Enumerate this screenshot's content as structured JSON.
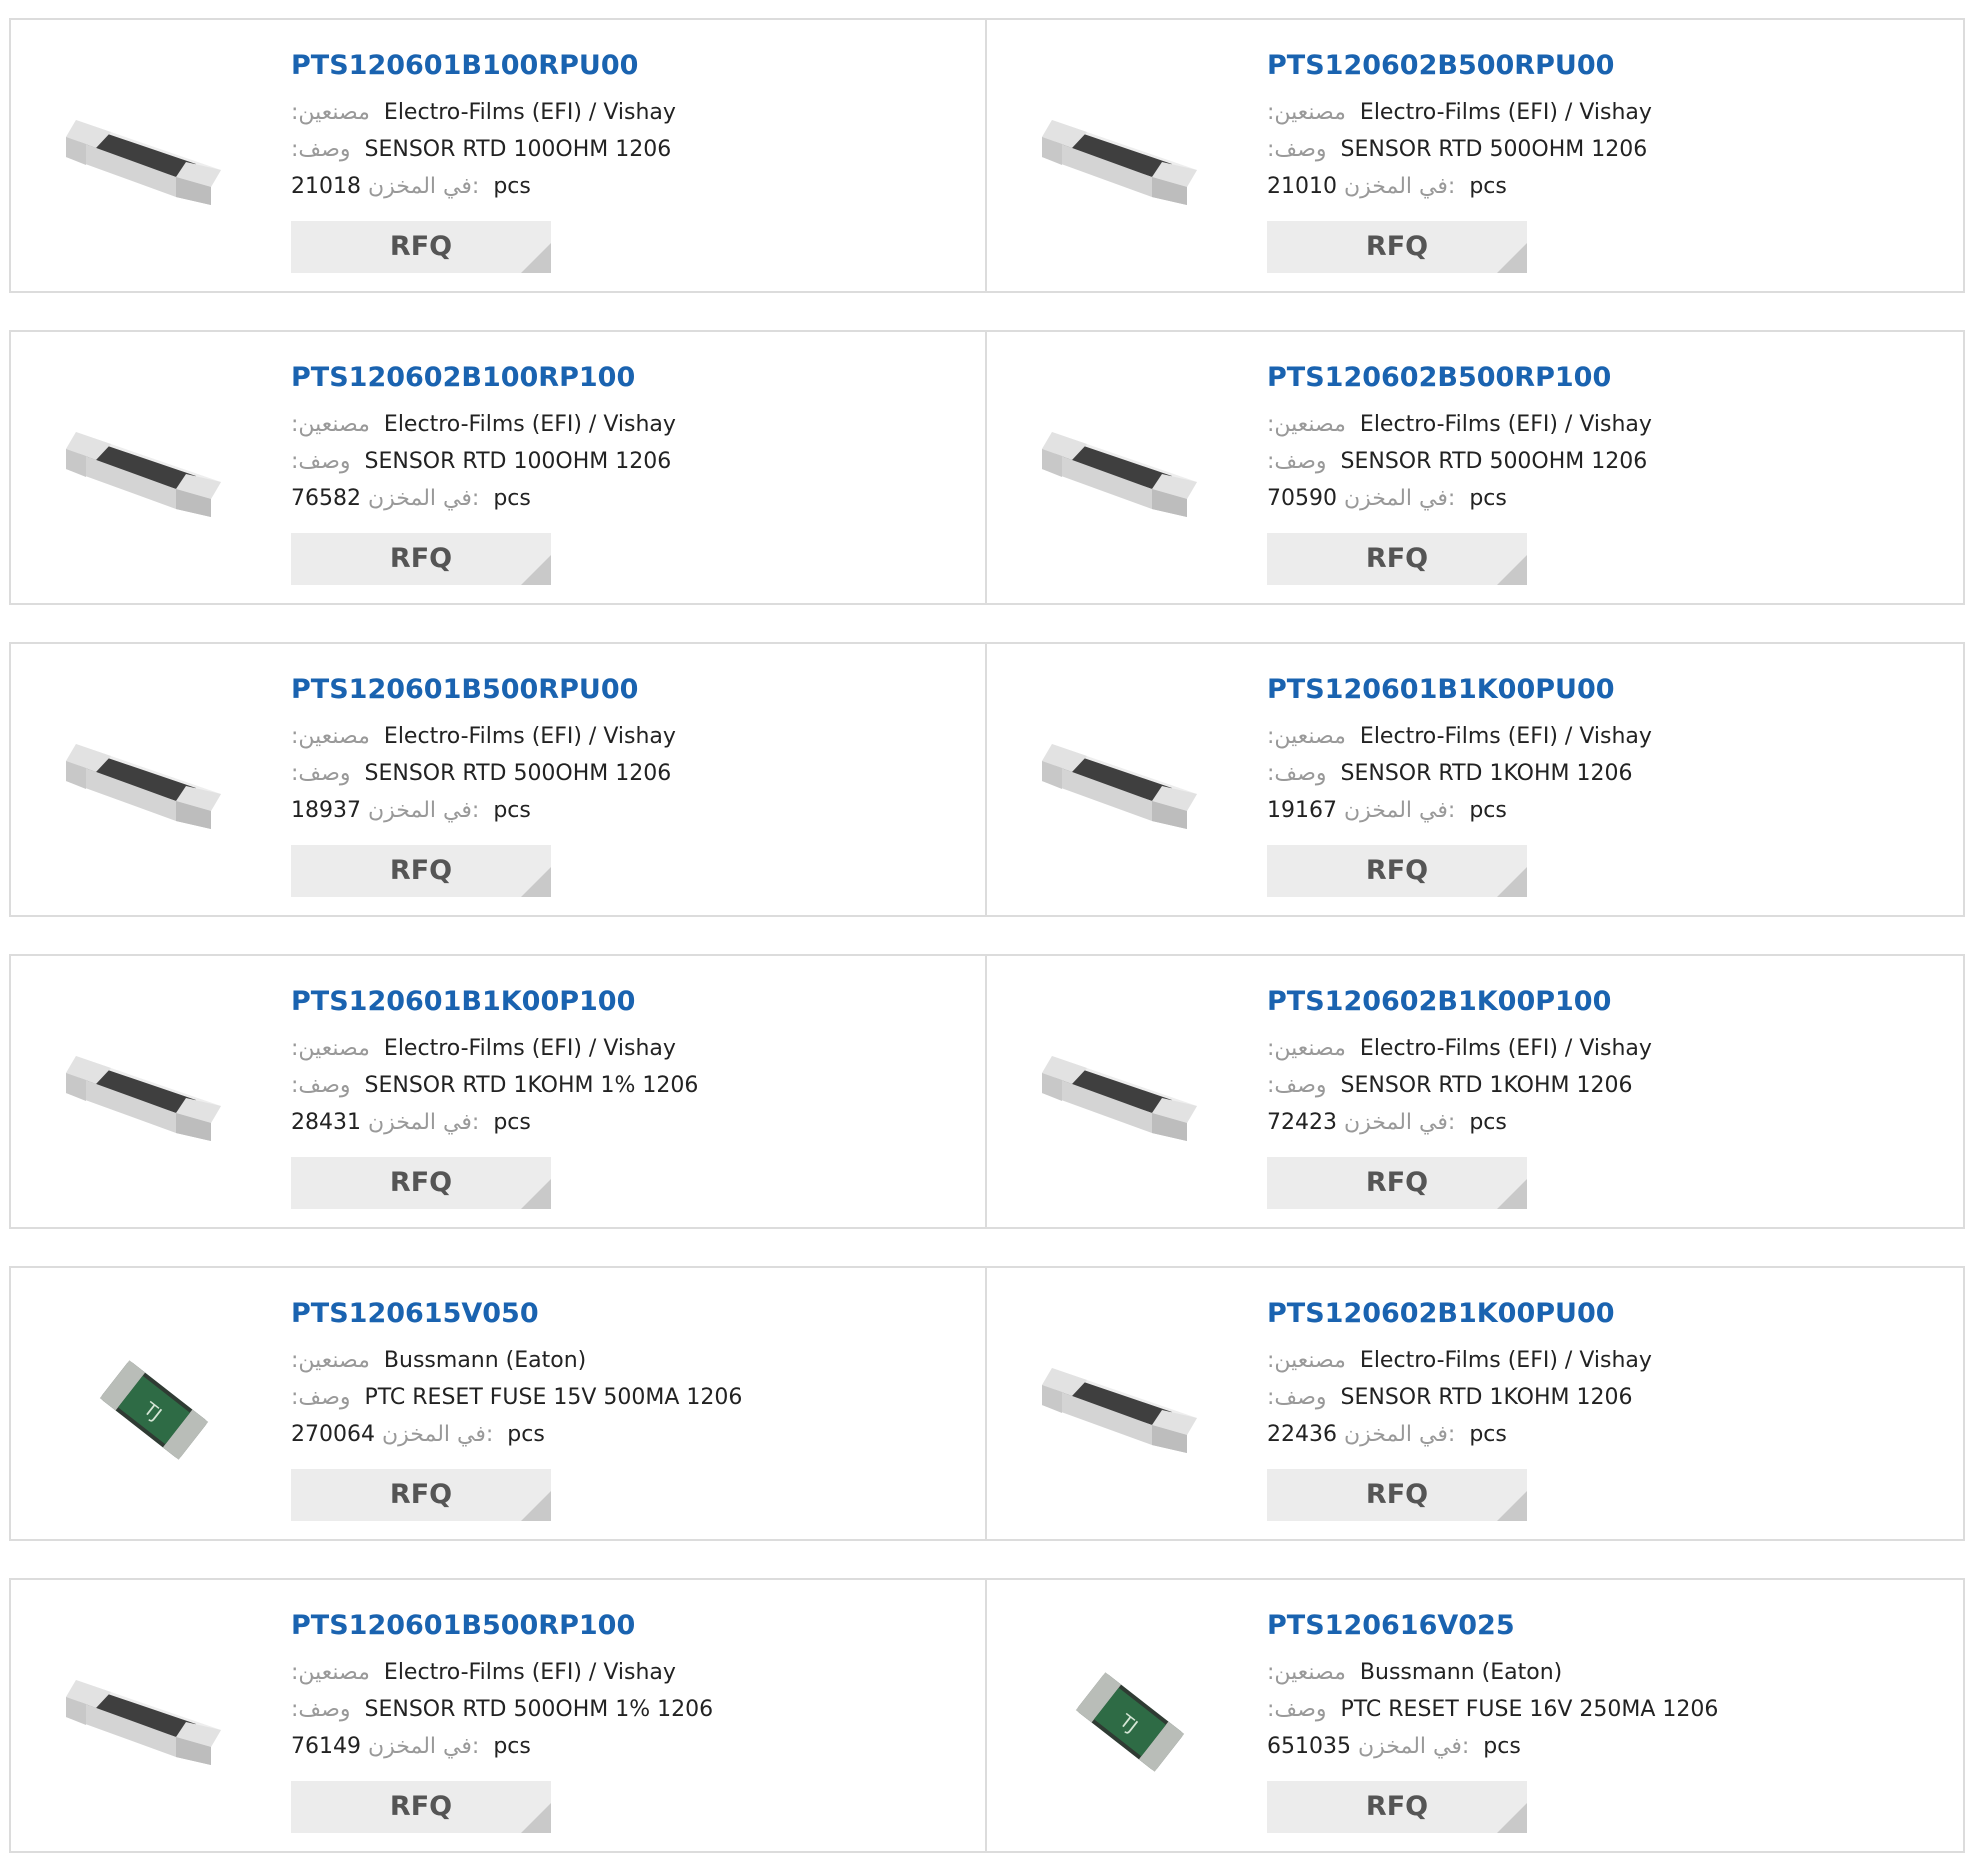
{
  "labels": {
    "manufacturer": ":مصنعين",
    "description": ":وصف",
    "stock": "في المخزن:",
    "unit": "pcs",
    "rfq": "RFQ"
  },
  "products": [
    {
      "part": "PTS120601B100RPU00",
      "manufacturer": "Electro-Films (EFI) / Vishay",
      "description": "SENSOR RTD 100OHM 1206",
      "stock": "21018",
      "image": "resistor-chip-icon"
    },
    {
      "part": "PTS120602B500RPU00",
      "manufacturer": "Electro-Films (EFI) / Vishay",
      "description": "SENSOR RTD 500OHM 1206",
      "stock": "21010",
      "image": "resistor-chip-icon"
    },
    {
      "part": "PTS120602B100RP100",
      "manufacturer": "Electro-Films (EFI) / Vishay",
      "description": "SENSOR RTD 100OHM 1206",
      "stock": "76582",
      "image": "resistor-chip-icon"
    },
    {
      "part": "PTS120602B500RP100",
      "manufacturer": "Electro-Films (EFI) / Vishay",
      "description": "SENSOR RTD 500OHM 1206",
      "stock": "70590",
      "image": "resistor-chip-icon"
    },
    {
      "part": "PTS120601B500RPU00",
      "manufacturer": "Electro-Films (EFI) / Vishay",
      "description": "SENSOR RTD 500OHM 1206",
      "stock": "18937",
      "image": "resistor-chip-icon"
    },
    {
      "part": "PTS120601B1K00PU00",
      "manufacturer": "Electro-Films (EFI) / Vishay",
      "description": "SENSOR RTD 1KOHM 1206",
      "stock": "19167",
      "image": "resistor-chip-icon"
    },
    {
      "part": "PTS120601B1K00P100",
      "manufacturer": "Electro-Films (EFI) / Vishay",
      "description": "SENSOR RTD 1KOHM 1% 1206",
      "stock": "28431",
      "image": "resistor-chip-icon"
    },
    {
      "part": "PTS120602B1K00P100",
      "manufacturer": "Electro-Films (EFI) / Vishay",
      "description": "SENSOR RTD 1KOHM 1206",
      "stock": "72423",
      "image": "resistor-chip-icon"
    },
    {
      "part": "PTS120615V050",
      "manufacturer": "Bussmann (Eaton)",
      "description": "PTC RESET FUSE 15V 500MA 1206",
      "stock": "270064",
      "image": "ptc-fuse-icon"
    },
    {
      "part": "PTS120602B1K00PU00",
      "manufacturer": "Electro-Films (EFI) / Vishay",
      "description": "SENSOR RTD 1KOHM 1206",
      "stock": "22436",
      "image": "resistor-chip-icon"
    },
    {
      "part": "PTS120601B500RP100",
      "manufacturer": "Electro-Films (EFI) / Vishay",
      "description": "SENSOR RTD 500OHM 1% 1206",
      "stock": "76149",
      "image": "resistor-chip-icon"
    },
    {
      "part": "PTS120616V025",
      "manufacturer": "Bussmann (Eaton)",
      "description": "PTC RESET FUSE 16V 250MA 1206",
      "stock": "651035",
      "image": "ptc-fuse-icon"
    }
  ],
  "colors": {
    "part_link": "#1a63b0",
    "label": "#999999",
    "rfq_bg": "#ececec",
    "border": "#dcdcdc"
  }
}
